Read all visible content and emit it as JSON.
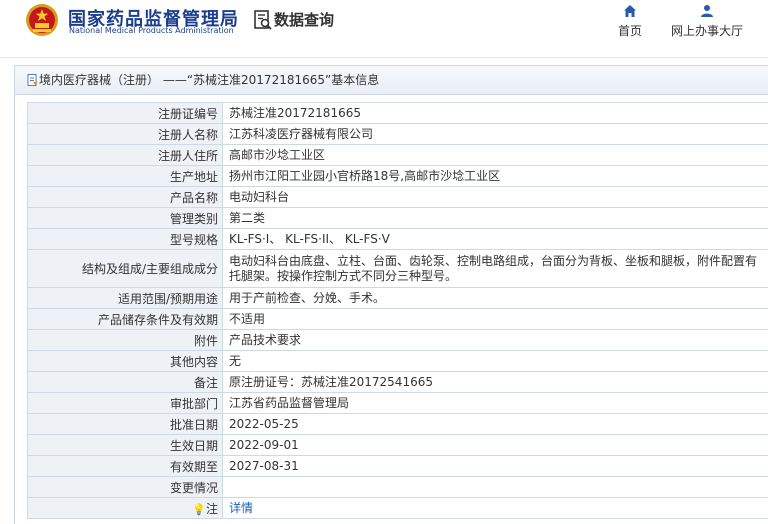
{
  "header": {
    "site_title": "国家药品监督管理局",
    "site_subtitle": "National Medical Products Administration",
    "query_label": "数据查询",
    "nav": [
      {
        "label": "首页",
        "icon": "home-icon"
      },
      {
        "label": "网上办事大厅",
        "icon": "user-icon"
      }
    ]
  },
  "panel": {
    "title": "境内医疗器械（注册） ——“苏械注准20172181665”基本信息"
  },
  "rows": [
    {
      "label": "注册证编号",
      "value": "苏械注准20172181665"
    },
    {
      "label": "注册人名称",
      "value": "江苏科凌医疗器械有限公司"
    },
    {
      "label": "注册人住所",
      "value": "高邮市沙埝工业区"
    },
    {
      "label": "生产地址",
      "value": "扬州市江阳工业园小官桥路18号,高邮市沙埝工业区"
    },
    {
      "label": "产品名称",
      "value": "电动妇科台"
    },
    {
      "label": "管理类别",
      "value": "第二类"
    },
    {
      "label": "型号规格",
      "value": "KL-FS·I、 KL-FS·II、 KL-FS·V"
    },
    {
      "label": "结构及组成/主要组成成分",
      "value": "电动妇科台由底盘、立柱、台面、齿轮泵、控制电路组成，台面分为背板、坐板和腿板，附件配置有托腿架。按操作控制方式不同分三种型号。"
    },
    {
      "label": "适用范围/预期用途",
      "value": "用于产前检查、分娩、手术。"
    },
    {
      "label": "产品储存条件及有效期",
      "value": "不适用"
    },
    {
      "label": "附件",
      "value": "产品技术要求"
    },
    {
      "label": "其他内容",
      "value": "无"
    },
    {
      "label": "备注",
      "value": "原注册证号：苏械注准20172541665"
    },
    {
      "label": "审批部门",
      "value": "江苏省药品监督管理局"
    },
    {
      "label": "批准日期",
      "value": "2022-05-25"
    },
    {
      "label": "生效日期",
      "value": "2022-09-01"
    },
    {
      "label": "有效期至",
      "value": "2027-08-31"
    },
    {
      "label": "变更情况",
      "value": ""
    },
    {
      "label": "注",
      "value": "详情",
      "icon": "bulb-icon"
    }
  ],
  "colors": {
    "brand": "#1b3e8f",
    "link": "#1b63b5",
    "label_bg": "#eef2f7",
    "border": "#cfd8e3"
  }
}
